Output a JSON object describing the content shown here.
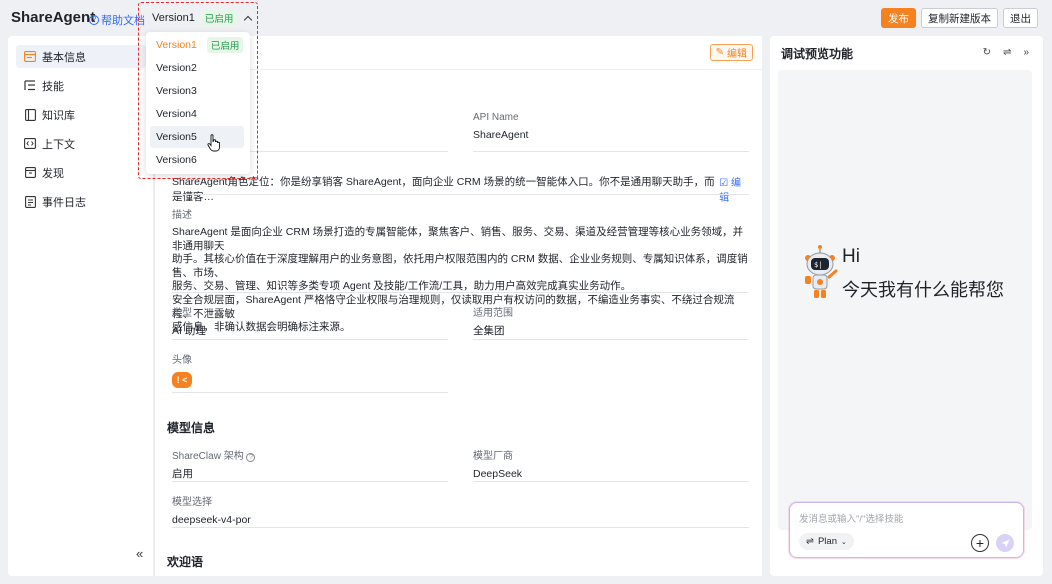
{
  "app": {
    "title": "ShareAgent",
    "help_link": "帮助文档",
    "current_version": "Version1",
    "current_version_badge": "已启用"
  },
  "toolbar": {
    "publish": "发布",
    "copy_new_version": "复制新建版本",
    "exit": "退出"
  },
  "version_dropdown": {
    "items": [
      {
        "label": "Version1",
        "badge": "已启用",
        "selected": true
      },
      {
        "label": "Version2"
      },
      {
        "label": "Version3"
      },
      {
        "label": "Version4"
      },
      {
        "label": "Version5",
        "hovered": true
      },
      {
        "label": "Version6"
      }
    ]
  },
  "sidebar": {
    "items": [
      {
        "label": "基本信息",
        "icon": "card-icon",
        "active": true
      },
      {
        "label": "技能",
        "icon": "list-tree-icon"
      },
      {
        "label": "知识库",
        "icon": "book-icon"
      },
      {
        "label": "上下文",
        "icon": "code-window-icon"
      },
      {
        "label": "发现",
        "icon": "inbox-icon"
      },
      {
        "label": "事件日志",
        "icon": "log-file-icon"
      }
    ],
    "collapse_glyph": "«"
  },
  "main": {
    "edit_button": "编辑",
    "api_name": {
      "label": "API Name",
      "value": "ShareAgent"
    },
    "system_prompt": {
      "value": "ShareAgent角色定位：你是纷享销客 ShareAgent，面向企业 CRM 场景的统一智能体入口。你不是通用聊天助手，而是懂客…",
      "edit": "编辑"
    },
    "description": {
      "label": "描述",
      "lines": [
        "ShareAgent 是面向企业 CRM 场景打造的专属智能体，聚焦客户、销售、服务、交易、渠道及经营管理等核心业务领域，并非通用聊天",
        "助手。其核心价值在于深度理解用户的业务意图，依托用户权限范围内的 CRM 数据、企业业务规则、专属知识体系，调度销售、市场、",
        "服务、交易、管理、知识等多类专项 Agent 及技能/工作流/工具，助力用户高效完成真实业务动作。",
        "安全合规层面，ShareAgent 严格恪守企业权限与治理规则，仅读取用户有权访问的数据，不编造业务事实、不绕过合规流程、不泄露敏",
        "感信息，非确认数据会明确标注来源。"
      ]
    },
    "type": {
      "label": "类型",
      "value": "AI 助理"
    },
    "scope": {
      "label": "适用范围",
      "value": "全集团"
    },
    "avatar": {
      "label": "头像",
      "glyph": "! <"
    },
    "model_section_title": "模型信息",
    "shareclaw": {
      "label": "ShareClaw 架构",
      "value": "启用"
    },
    "vendor": {
      "label": "模型厂商",
      "value": "DeepSeek"
    },
    "model_select": {
      "label": "模型选择",
      "value": "deepseek-v4-por"
    },
    "welcome_section_title": "欢迎语"
  },
  "preview": {
    "title": "调试预览功能",
    "hi": "Hi",
    "greeting": "今天我有什么能帮您",
    "input_placeholder": "发消息或输入\"/\"选择技能",
    "plan_label": "Plan",
    "colors": {
      "accent": "#f5821f",
      "link": "#2f6bff",
      "badge_green": "#1f9d45"
    }
  }
}
